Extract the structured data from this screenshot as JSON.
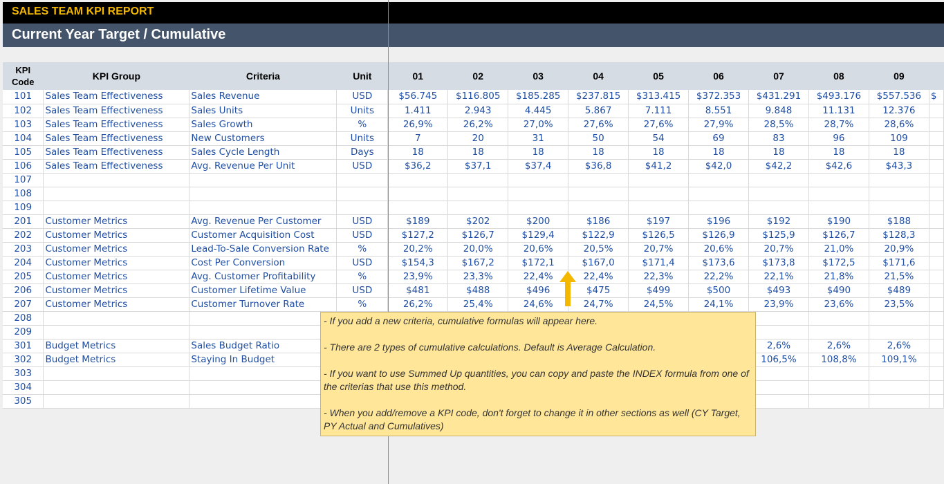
{
  "report": {
    "title": "SALES TEAM KPI REPORT",
    "subtitle": "Current Year Target / Cumulative"
  },
  "table": {
    "headers": {
      "code_line1": "KPI",
      "code_line2": "Code",
      "group": "KPI Group",
      "criteria": "Criteria",
      "unit": "Unit",
      "months": [
        "01",
        "02",
        "03",
        "04",
        "05",
        "06",
        "07",
        "08",
        "09"
      ]
    },
    "rows": [
      {
        "code": "101",
        "group": "Sales Team Effectiveness",
        "criteria": "Sales Revenue",
        "unit": "USD",
        "values": [
          "$56.745",
          "$116.805",
          "$185.285",
          "$237.815",
          "$313.415",
          "$372.353",
          "$431.291",
          "$493.176",
          "$557.536"
        ],
        "overflow": "$"
      },
      {
        "code": "102",
        "group": "Sales Team Effectiveness",
        "criteria": "Sales Units",
        "unit": "Units",
        "values": [
          "1.411",
          "2.943",
          "4.445",
          "5.867",
          "7.111",
          "8.551",
          "9.848",
          "11.131",
          "12.376"
        ]
      },
      {
        "code": "103",
        "group": "Sales Team Effectiveness",
        "criteria": "Sales Growth",
        "unit": "%",
        "values": [
          "26,9%",
          "26,2%",
          "27,0%",
          "27,6%",
          "27,6%",
          "27,9%",
          "28,5%",
          "28,7%",
          "28,6%"
        ]
      },
      {
        "code": "104",
        "group": "Sales Team Effectiveness",
        "criteria": "New Customers",
        "unit": "Units",
        "values": [
          "7",
          "20",
          "31",
          "50",
          "54",
          "69",
          "83",
          "96",
          "109"
        ]
      },
      {
        "code": "105",
        "group": "Sales Team Effectiveness",
        "criteria": "Sales Cycle Length",
        "unit": "Days",
        "values": [
          "18",
          "18",
          "18",
          "18",
          "18",
          "18",
          "18",
          "18",
          "18"
        ]
      },
      {
        "code": "106",
        "group": "Sales Team Effectiveness",
        "criteria": "Avg. Revenue Per Unit",
        "unit": "USD",
        "values": [
          "$36,2",
          "$37,1",
          "$37,4",
          "$36,8",
          "$41,2",
          "$42,0",
          "$42,2",
          "$42,6",
          "$43,3"
        ]
      },
      {
        "code": "107",
        "group": "",
        "criteria": "",
        "unit": "",
        "values": [
          "",
          "",
          "",
          "",
          "",
          "",
          "",
          "",
          ""
        ]
      },
      {
        "code": "108",
        "group": "",
        "criteria": "",
        "unit": "",
        "values": [
          "",
          "",
          "",
          "",
          "",
          "",
          "",
          "",
          ""
        ]
      },
      {
        "code": "109",
        "group": "",
        "criteria": "",
        "unit": "",
        "values": [
          "",
          "",
          "",
          "",
          "",
          "",
          "",
          "",
          ""
        ]
      },
      {
        "code": "201",
        "group": "Customer Metrics",
        "criteria": "Avg. Revenue Per Customer",
        "unit": "USD",
        "values": [
          "$189",
          "$202",
          "$200",
          "$186",
          "$197",
          "$196",
          "$192",
          "$190",
          "$188"
        ]
      },
      {
        "code": "202",
        "group": "Customer Metrics",
        "criteria": "Customer Acquisition Cost",
        "unit": "USD",
        "values": [
          "$127,2",
          "$126,7",
          "$129,4",
          "$122,9",
          "$126,5",
          "$126,9",
          "$125,9",
          "$126,7",
          "$128,3"
        ]
      },
      {
        "code": "203",
        "group": "Customer Metrics",
        "criteria": "Lead-To-Sale Conversion Rate",
        "unit": "%",
        "values": [
          "20,2%",
          "20,0%",
          "20,6%",
          "20,5%",
          "20,7%",
          "20,6%",
          "20,7%",
          "21,0%",
          "20,9%"
        ]
      },
      {
        "code": "204",
        "group": "Customer Metrics",
        "criteria": "Cost Per Conversion",
        "unit": "USD",
        "values": [
          "$154,3",
          "$167,2",
          "$172,1",
          "$167,0",
          "$171,4",
          "$173,6",
          "$173,8",
          "$172,5",
          "$171,6"
        ]
      },
      {
        "code": "205",
        "group": "Customer Metrics",
        "criteria": "Avg. Customer Profitability",
        "unit": "%",
        "values": [
          "23,9%",
          "23,3%",
          "22,4%",
          "22,4%",
          "22,3%",
          "22,2%",
          "22,1%",
          "21,8%",
          "21,5%"
        ]
      },
      {
        "code": "206",
        "group": "Customer Metrics",
        "criteria": "Customer Lifetime Value",
        "unit": "USD",
        "values": [
          "$481",
          "$488",
          "$496",
          "$475",
          "$499",
          "$500",
          "$493",
          "$490",
          "$489"
        ]
      },
      {
        "code": "207",
        "group": "Customer Metrics",
        "criteria": "Customer Turnover Rate",
        "unit": "%",
        "values": [
          "26,2%",
          "25,4%",
          "24,6%",
          "24,7%",
          "24,5%",
          "24,1%",
          "23,9%",
          "23,6%",
          "23,5%"
        ]
      },
      {
        "code": "208",
        "group": "",
        "criteria": "",
        "unit": "",
        "values": [
          "",
          "",
          "",
          "",
          "",
          "",
          "",
          "",
          ""
        ]
      },
      {
        "code": "209",
        "group": "",
        "criteria": "",
        "unit": "",
        "values": [
          "",
          "",
          "",
          "",
          "",
          "",
          "",
          "",
          ""
        ]
      },
      {
        "code": "301",
        "group": "Budget Metrics",
        "criteria": "Sales Budget Ratio",
        "unit": "",
        "values": [
          "",
          "",
          "",
          "",
          "",
          "",
          "2,6%",
          "2,6%",
          "2,6%"
        ]
      },
      {
        "code": "302",
        "group": "Budget Metrics",
        "criteria": "Staying In Budget",
        "unit": "",
        "values": [
          "",
          "",
          "",
          "",
          "",
          "",
          "106,5%",
          "108,8%",
          "109,1%"
        ]
      },
      {
        "code": "303",
        "group": "",
        "criteria": "",
        "unit": "",
        "values": [
          "",
          "",
          "",
          "",
          "",
          "",
          "",
          "",
          ""
        ]
      },
      {
        "code": "304",
        "group": "",
        "criteria": "",
        "unit": "",
        "values": [
          "",
          "",
          "",
          "",
          "",
          "",
          "",
          "",
          ""
        ]
      },
      {
        "code": "305",
        "group": "",
        "criteria": "",
        "unit": "",
        "values": [
          "",
          "",
          "",
          "",
          "",
          "",
          "",
          "",
          ""
        ]
      }
    ]
  },
  "note": {
    "lines": [
      "- If you add a new criteria, cumulative formulas will appear here.",
      "- There are 2 types of cumulative calculations. Default is Average Calculation.",
      "- If you want to use Summed Up quantities, you can copy and paste the INDEX formula from one of the criterias that use this method.",
      "- When you add/remove a KPI code, don't forget to change it in other sections as well (CY Target, PY Actual and Cumulatives)"
    ]
  },
  "arrow": {
    "icon": "arrow-up-icon",
    "color": "#f5b800"
  }
}
